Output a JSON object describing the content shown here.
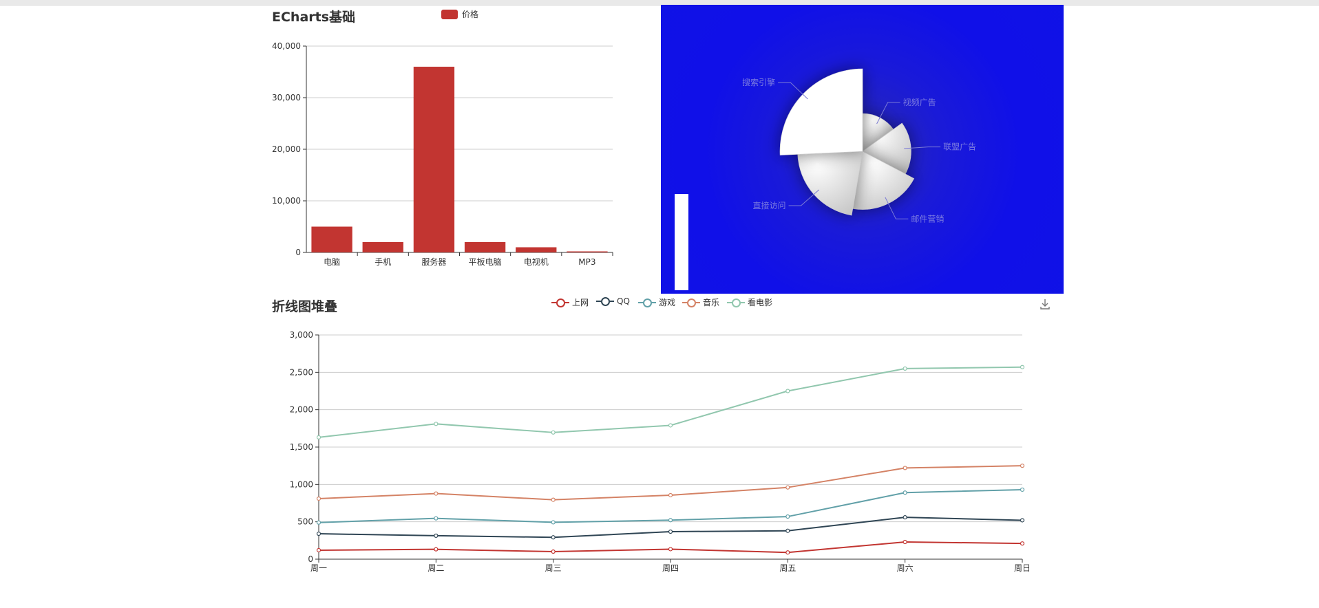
{
  "chart_data": [
    {
      "type": "bar",
      "title": "ECharts基础",
      "legend": [
        "价格"
      ],
      "legend_position": "top-center",
      "categories": [
        "电脑",
        "手机",
        "服务器",
        "平板电脑",
        "电视机",
        "MP3"
      ],
      "series": [
        {
          "name": "价格",
          "values": [
            5000,
            2000,
            36000,
            2000,
            1000,
            200
          ],
          "color": "#c23531"
        }
      ],
      "ylim": [
        0,
        40000
      ],
      "yticks": [
        "0",
        "10,000",
        "20,000",
        "30,000",
        "40,000"
      ],
      "grid": true
    },
    {
      "type": "pie",
      "background_color": "#0f12e6",
      "slices": [
        {
          "label": "视频广告",
          "value": 235
        },
        {
          "label": "联盟广告",
          "value": 274
        },
        {
          "label": "邮件营销",
          "value": 310
        },
        {
          "label": "直接访问",
          "value": 335
        },
        {
          "label": "搜索引擎",
          "value": 400
        }
      ],
      "roseType": "radius"
    },
    {
      "type": "line",
      "title": "折线图堆叠",
      "legend": [
        "上网",
        "QQ",
        "游戏",
        "音乐",
        "看电影"
      ],
      "legend_position": "top-center",
      "categories": [
        "周一",
        "周二",
        "周三",
        "周四",
        "周五",
        "周六",
        "周日"
      ],
      "ylim": [
        0,
        3000
      ],
      "yticks": [
        "0",
        "500",
        "1,000",
        "1,500",
        "2,000",
        "2,500",
        "3,000"
      ],
      "stacked": true,
      "series": [
        {
          "name": "上网",
          "color": "#c23531",
          "values": [
            120,
            132,
            101,
            134,
            90,
            230,
            210
          ]
        },
        {
          "name": "QQ",
          "color": "#2f4554",
          "values": [
            340,
            314,
            292,
            368,
            380,
            560,
            520
          ]
        },
        {
          "name": "游戏",
          "color": "#61a0a8",
          "values": [
            490,
            546,
            493,
            522,
            570,
            890,
            930
          ]
        },
        {
          "name": "音乐",
          "color": "#d48265",
          "values": [
            810,
            878,
            795,
            856,
            960,
            1220,
            1250
          ]
        },
        {
          "name": "看电影",
          "color": "#91c7ae",
          "values": [
            1630,
            1810,
            1695,
            1790,
            2250,
            2550,
            2570
          ]
        }
      ],
      "grid": true
    }
  ],
  "icons": {
    "toolbox": "download-icon"
  }
}
